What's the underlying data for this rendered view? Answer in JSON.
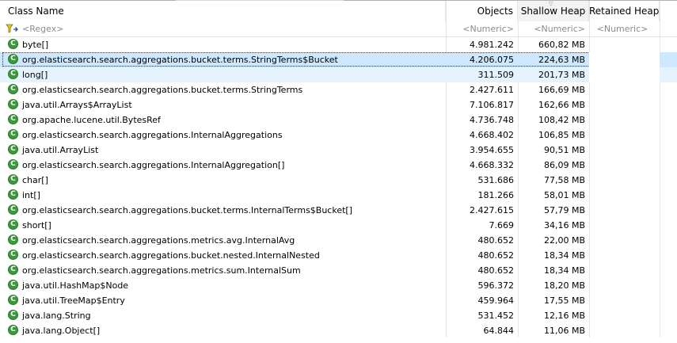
{
  "columns": {
    "class_name": "Class Name",
    "objects": "Objects",
    "shallow_heap": "Shallow Heap",
    "retained_heap": "Retained Heap"
  },
  "filter": {
    "class_name": "<Regex>",
    "objects": "<Numeric>",
    "shallow_heap": "<Numeric>",
    "retained_heap": "<Numeric>"
  },
  "rows": [
    {
      "name": "byte[]",
      "objects": "4.981.242",
      "shallow": "660,82 MB",
      "retained": ""
    },
    {
      "name": "org.elasticsearch.search.aggregations.bucket.terms.StringTerms$Bucket",
      "objects": "4.206.075",
      "shallow": "224,63 MB",
      "retained": ""
    },
    {
      "name": "long[]",
      "objects": "311.509",
      "shallow": "201,73 MB",
      "retained": ""
    },
    {
      "name": "org.elasticsearch.search.aggregations.bucket.terms.StringTerms",
      "objects": "2.427.611",
      "shallow": "166,69 MB",
      "retained": ""
    },
    {
      "name": "java.util.Arrays$ArrayList",
      "objects": "7.106.817",
      "shallow": "162,66 MB",
      "retained": ""
    },
    {
      "name": "org.apache.lucene.util.BytesRef",
      "objects": "4.736.748",
      "shallow": "108,42 MB",
      "retained": ""
    },
    {
      "name": "org.elasticsearch.search.aggregations.InternalAggregations",
      "objects": "4.668.402",
      "shallow": "106,85 MB",
      "retained": ""
    },
    {
      "name": "java.util.ArrayList",
      "objects": "3.954.655",
      "shallow": "90,51 MB",
      "retained": ""
    },
    {
      "name": "org.elasticsearch.search.aggregations.InternalAggregation[]",
      "objects": "4.668.332",
      "shallow": "86,09 MB",
      "retained": ""
    },
    {
      "name": "char[]",
      "objects": "531.686",
      "shallow": "77,58 MB",
      "retained": ""
    },
    {
      "name": "int[]",
      "objects": "181.266",
      "shallow": "58,01 MB",
      "retained": ""
    },
    {
      "name": "org.elasticsearch.search.aggregations.bucket.terms.InternalTerms$Bucket[]",
      "objects": "2.427.615",
      "shallow": "57,79 MB",
      "retained": ""
    },
    {
      "name": "short[]",
      "objects": "7.669",
      "shallow": "34,16 MB",
      "retained": ""
    },
    {
      "name": "org.elasticsearch.search.aggregations.metrics.avg.InternalAvg",
      "objects": "480.652",
      "shallow": "22,00 MB",
      "retained": ""
    },
    {
      "name": "org.elasticsearch.search.aggregations.bucket.nested.InternalNested",
      "objects": "480.652",
      "shallow": "18,34 MB",
      "retained": ""
    },
    {
      "name": "org.elasticsearch.search.aggregations.metrics.sum.InternalSum",
      "objects": "480.652",
      "shallow": "18,34 MB",
      "retained": ""
    },
    {
      "name": "java.util.HashMap$Node",
      "objects": "596.372",
      "shallow": "18,20 MB",
      "retained": ""
    },
    {
      "name": "java.util.TreeMap$Entry",
      "objects": "459.964",
      "shallow": "17,55 MB",
      "retained": ""
    },
    {
      "name": "java.lang.String",
      "objects": "531.452",
      "shallow": "12,16 MB",
      "retained": ""
    },
    {
      "name": "java.lang.Object[]",
      "objects": "64.844",
      "shallow": "11,06 MB",
      "retained": ""
    }
  ],
  "icons": {
    "class_icon": "class-c-icon",
    "class_icon_letter": "C",
    "class_icon_color": "#3a9a3a",
    "filter_icon": "filter-funnel-icon",
    "sort_icon": "sort-descending-icon"
  },
  "colors": {
    "selected_row": "#cde8ff",
    "hover_row": "#e5f3ff",
    "sorted_header": "#f3f3f3"
  }
}
